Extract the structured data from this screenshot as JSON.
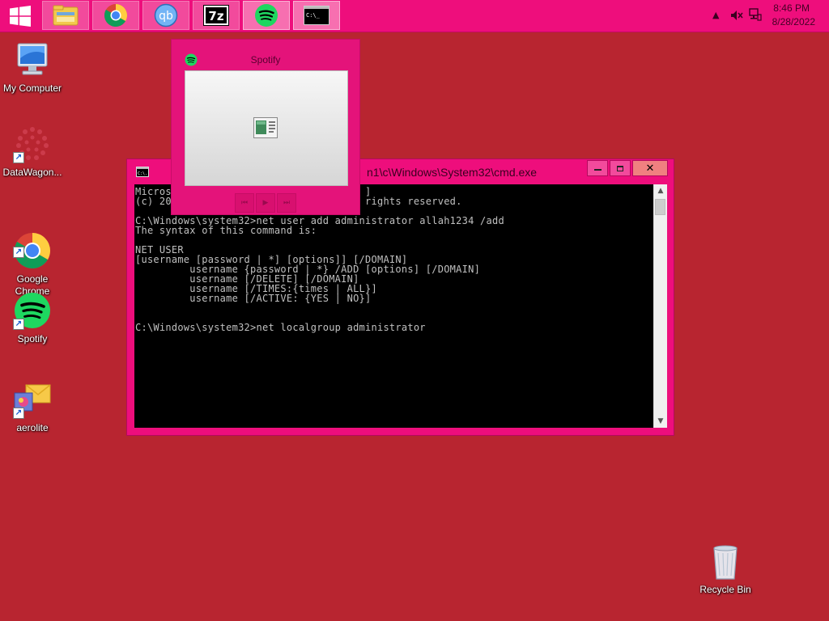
{
  "taskbar": {
    "apps": [
      {
        "name": "File Explorer",
        "icon": "folder-icon"
      },
      {
        "name": "Google Chrome",
        "icon": "chrome-icon"
      },
      {
        "name": "qBittorrent",
        "icon": "qbittorrent-icon",
        "label": "qb"
      },
      {
        "name": "7-Zip",
        "icon": "7zip-icon",
        "label": "7z"
      },
      {
        "name": "Spotify",
        "icon": "spotify-icon"
      },
      {
        "name": "Command Prompt",
        "icon": "cmd-icon",
        "label": "C:\\_"
      }
    ],
    "clock": {
      "time": "8:46 PM",
      "date": "8/28/2022"
    }
  },
  "desktop": {
    "icons": [
      {
        "label": "My Computer",
        "icon": "computer-icon"
      },
      {
        "label": "DataWagon...",
        "icon": "datawagon-icon"
      },
      {
        "label": "Google\nChrome",
        "icon": "chrome-icon"
      },
      {
        "label": "Spotify",
        "icon": "spotify-icon"
      },
      {
        "label": "aerolite",
        "icon": "aerolite-icon"
      },
      {
        "label": "Recycle Bin",
        "icon": "recycle-bin-icon"
      }
    ]
  },
  "spotify_thumbnail": {
    "title": "Spotify"
  },
  "cmd": {
    "title": "n1\\c\\Windows\\System32\\cmd.exe",
    "icon_label": "C:\\.",
    "controls": {
      "minimize": "▬",
      "maximize": "▭",
      "close": "✕"
    },
    "output": "Micros                                ]\n(c) 20                                rights reserved.\n\nC:\\Windows\\system32>net user add administrator allah1234 /add\nThe syntax of this command is:\n\nNET USER\n[username [password | *] [options]] [/DOMAIN]\n         username {password | *} /ADD [options] [/DOMAIN]\n         username [/DELETE] [/DOMAIN]\n         username [/TIMES:{times | ALL}]\n         username [/ACTIVE: {YES | NO}]\n\n\nC:\\Windows\\system32>net localgroup administrator"
  },
  "colors": {
    "desktop": "#b82530",
    "taskbar": "#ee0e7c",
    "spotify_green": "#1ed760"
  }
}
